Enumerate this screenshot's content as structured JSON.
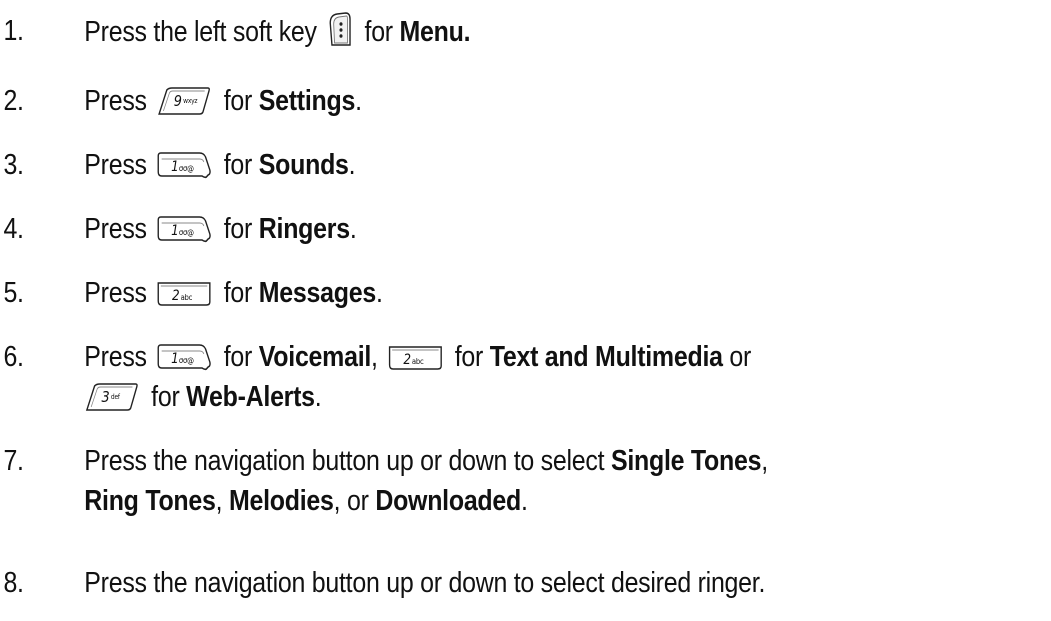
{
  "steps": [
    {
      "number": "1.",
      "before": "Press the left soft key",
      "key": "left-soft-key-icon",
      "middle": "for",
      "bold": "Menu."
    },
    {
      "number": "2.",
      "before": "Press",
      "key": "9-wxyz-key-icon",
      "key_digit": "9",
      "key_letters": "wxyz",
      "middle": "for",
      "bold": "Settings",
      "after": "."
    },
    {
      "number": "3.",
      "before": "Press",
      "key": "1-key-icon",
      "key_digit": "1",
      "key_letters": "σσ@",
      "middle": "for",
      "bold": "Sounds",
      "after": "."
    },
    {
      "number": "4.",
      "before": "Press",
      "key": "1-key-icon",
      "key_digit": "1",
      "key_letters": "σσ@",
      "middle": "for",
      "bold": "Ringers",
      "after": "."
    },
    {
      "number": "5.",
      "before": "Press",
      "key": "2-abc-key-icon",
      "key_digit": "2",
      "key_letters": "abc",
      "middle": "for",
      "bold": "Messages",
      "after": "."
    },
    {
      "number": "6.",
      "before": "Press",
      "key_a": "1-key-icon",
      "key_a_digit": "1",
      "key_a_letters": "σσ@",
      "middle_a": "for",
      "bold_a": "Voicemail",
      "sep_a": ",",
      "key_b": "2-abc-key-icon",
      "key_b_digit": "2",
      "key_b_letters": "abc",
      "middle_b": "for",
      "bold_b": "Text and Multimedia",
      "sep_b": "or",
      "key_c": "3-def-key-icon",
      "key_c_digit": "3",
      "key_c_letters": "def",
      "middle_c": "for",
      "bold_c": "Web-Alerts",
      "after": "."
    },
    {
      "number": "7.",
      "line1": "Press the navigation button up or down to select",
      "bold1": "Single Tones",
      "sep1": ",",
      "bold2": "Ring Tones",
      "sep2": ",",
      "bold3": "Melodies",
      "sep3": ", or",
      "bold4": "Downloaded",
      "after": "."
    },
    {
      "number": "8.",
      "text": "Press the navigation button up or down to select desired ringer."
    }
  ]
}
